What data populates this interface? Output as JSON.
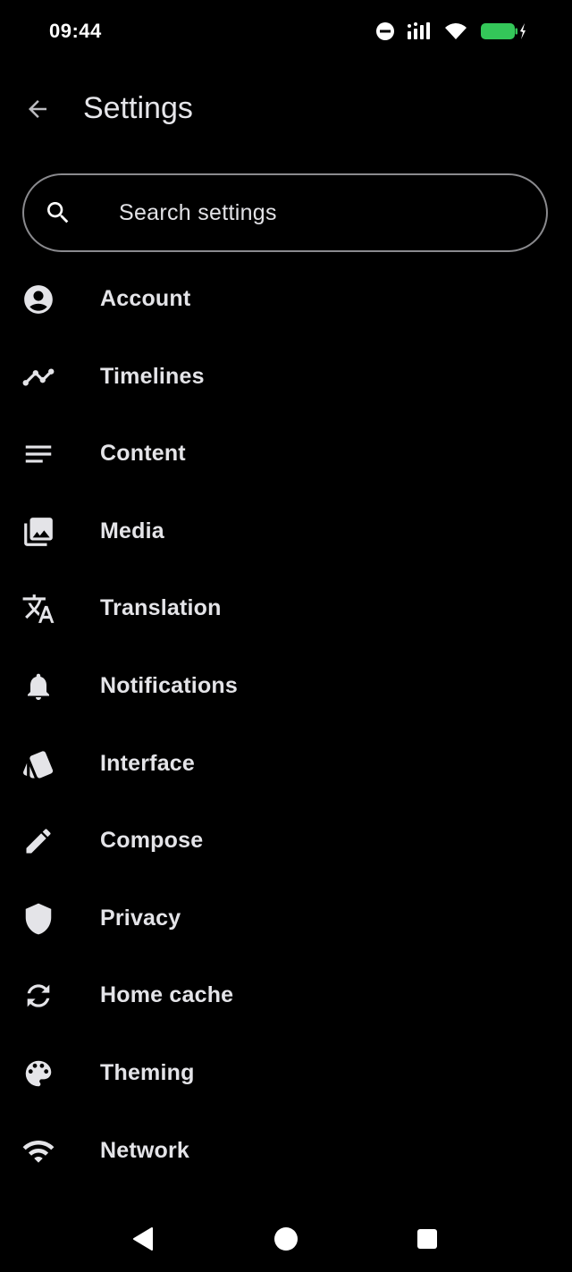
{
  "status_bar": {
    "time": "09:44",
    "icons": [
      "do-not-disturb-icon",
      "signal-icon",
      "wifi-icon",
      "battery-charging-icon"
    ],
    "battery_color": "#34c759"
  },
  "app_bar": {
    "title": "Settings",
    "back_icon": "arrow-back-icon"
  },
  "search": {
    "placeholder": "Search settings",
    "icon": "search-icon"
  },
  "settings_items": [
    {
      "label": "Account",
      "icon": "account-circle-icon"
    },
    {
      "label": "Timelines",
      "icon": "timeline-icon"
    },
    {
      "label": "Content",
      "icon": "notes-icon"
    },
    {
      "label": "Media",
      "icon": "photo-library-icon"
    },
    {
      "label": "Translation",
      "icon": "translate-icon"
    },
    {
      "label": "Notifications",
      "icon": "bell-icon"
    },
    {
      "label": "Interface",
      "icon": "style-icon"
    },
    {
      "label": "Compose",
      "icon": "pencil-icon"
    },
    {
      "label": "Privacy",
      "icon": "shield-icon"
    },
    {
      "label": "Home cache",
      "icon": "sync-icon"
    },
    {
      "label": "Theming",
      "icon": "palette-icon"
    },
    {
      "label": "Network",
      "icon": "wifi-icon"
    }
  ],
  "nav_bar": {
    "buttons": [
      "back-triangle-icon",
      "home-circle-icon",
      "recents-square-icon"
    ]
  },
  "colors": {
    "background": "#000000",
    "text": "#e4e4e8",
    "outline": "#8a8a8e"
  }
}
